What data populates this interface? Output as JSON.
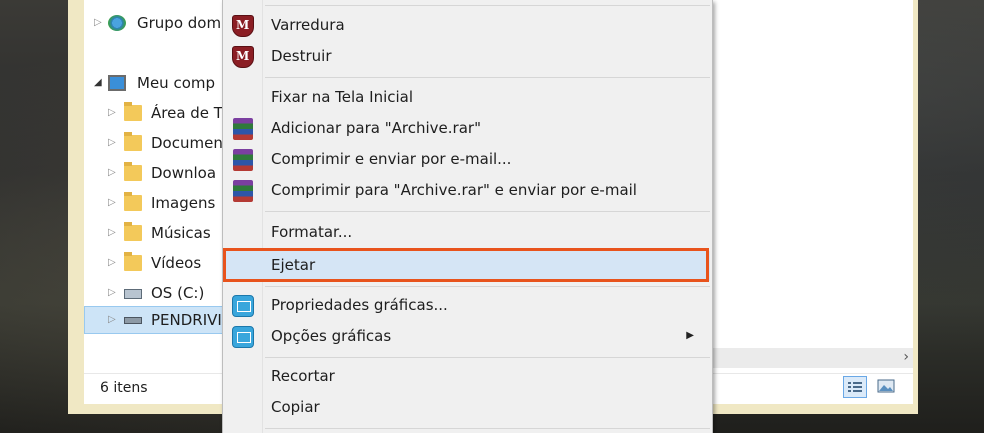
{
  "explorer": {
    "status": "6 itens",
    "tree": [
      {
        "label": "Grupo dom",
        "icon": "homegroup-icon"
      },
      {
        "label": "Meu comp",
        "icon": "computer-icon"
      },
      {
        "label": "Área de T",
        "icon": "desktop-folder-icon"
      },
      {
        "label": "Documen",
        "icon": "documents-folder-icon"
      },
      {
        "label": "Downloa",
        "icon": "downloads-folder-icon"
      },
      {
        "label": "Imagens",
        "icon": "pictures-folder-icon"
      },
      {
        "label": "Músicas",
        "icon": "music-folder-icon"
      },
      {
        "label": "Vídeos",
        "icon": "videos-folder-icon"
      },
      {
        "label": "OS (C:)",
        "icon": "drive-c-icon"
      },
      {
        "label": "PENDRIVI",
        "icon": "usb-drive-icon"
      }
    ]
  },
  "menu": {
    "items": [
      {
        "label": "Varredura",
        "icon": "mcafee-shield-icon"
      },
      {
        "label": "Destruir",
        "icon": "mcafee-shield-icon"
      },
      {
        "label": "Fixar na Tela Inicial"
      },
      {
        "label": "Adicionar para \"Archive.rar\"",
        "icon": "winrar-icon"
      },
      {
        "label": "Comprimir e enviar por e-mail...",
        "icon": "winrar-icon"
      },
      {
        "label": "Comprimir para \"Archive.rar\" e enviar por e-mail",
        "icon": "winrar-icon"
      },
      {
        "label": "Formatar..."
      },
      {
        "label": "Ejetar"
      },
      {
        "label": "Propriedades gráficas...",
        "icon": "intel-graphics-icon"
      },
      {
        "label": "Opções gráficas",
        "icon": "intel-graphics-icon"
      },
      {
        "label": "Recortar"
      },
      {
        "label": "Copiar"
      }
    ],
    "highlighted": "Ejetar",
    "highlight_color": "#e8531c"
  }
}
